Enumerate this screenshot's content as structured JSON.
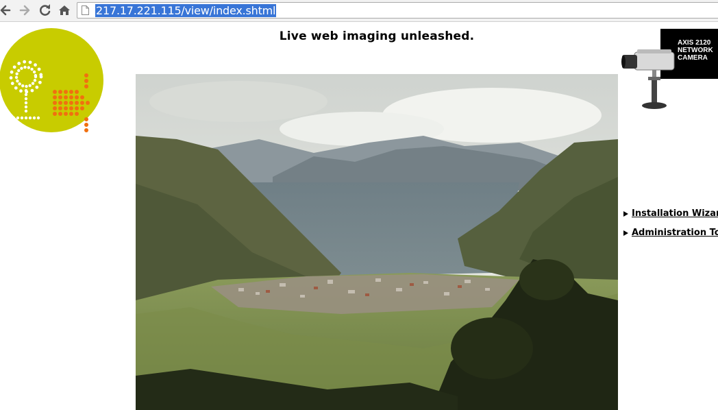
{
  "browser": {
    "url": "217.17.221.115/view/index.shtml"
  },
  "page": {
    "headline": "Live web imaging unleashed.",
    "camera_ad": {
      "text": "AXIS 2120\nNETWORK\nCAMERA"
    },
    "links": [
      {
        "label": "Installation Wizard"
      },
      {
        "label": "Administration Tools"
      }
    ]
  },
  "colors": {
    "logo_yellow": "#c8cc00",
    "logo_orange": "#f07010",
    "url_highlight": "#3875d7"
  }
}
